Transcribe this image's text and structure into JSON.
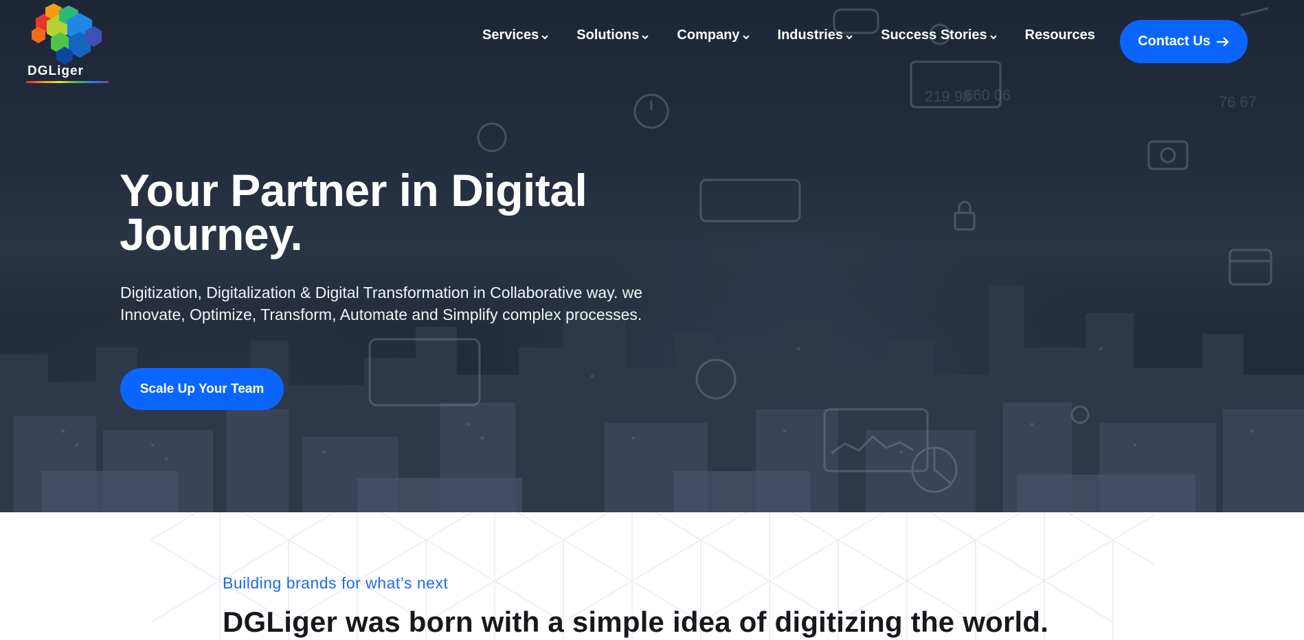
{
  "brand": {
    "logo_text": "DGLiger"
  },
  "nav": {
    "items": [
      {
        "label": "Services",
        "has_dropdown": true
      },
      {
        "label": "Solutions",
        "has_dropdown": true
      },
      {
        "label": "Company",
        "has_dropdown": true
      },
      {
        "label": "Industries",
        "has_dropdown": true
      },
      {
        "label": "Success Stories",
        "has_dropdown": true
      },
      {
        "label": "Resources",
        "has_dropdown": false
      }
    ],
    "contact_label": "Contact Us",
    "contact_icon": "arrow-right-icon"
  },
  "hero": {
    "title": "Your Partner in Digital Journey.",
    "subtitle": "Digitization, Digitalization & Digital Transformation in Collaborative way. we Innovate, Optimize, Transform, Automate and Simplify complex processes.",
    "cta_label": "Scale Up Your Team"
  },
  "about": {
    "eyebrow": "Building brands for what’s next",
    "title": "DGLiger was born with a simple idea of digitizing the world."
  },
  "colors": {
    "accent": "#0a66ff",
    "eyebrow": "#1a6bf0",
    "hero_overlay": "#232c3d",
    "heading_dark": "#16181d"
  }
}
